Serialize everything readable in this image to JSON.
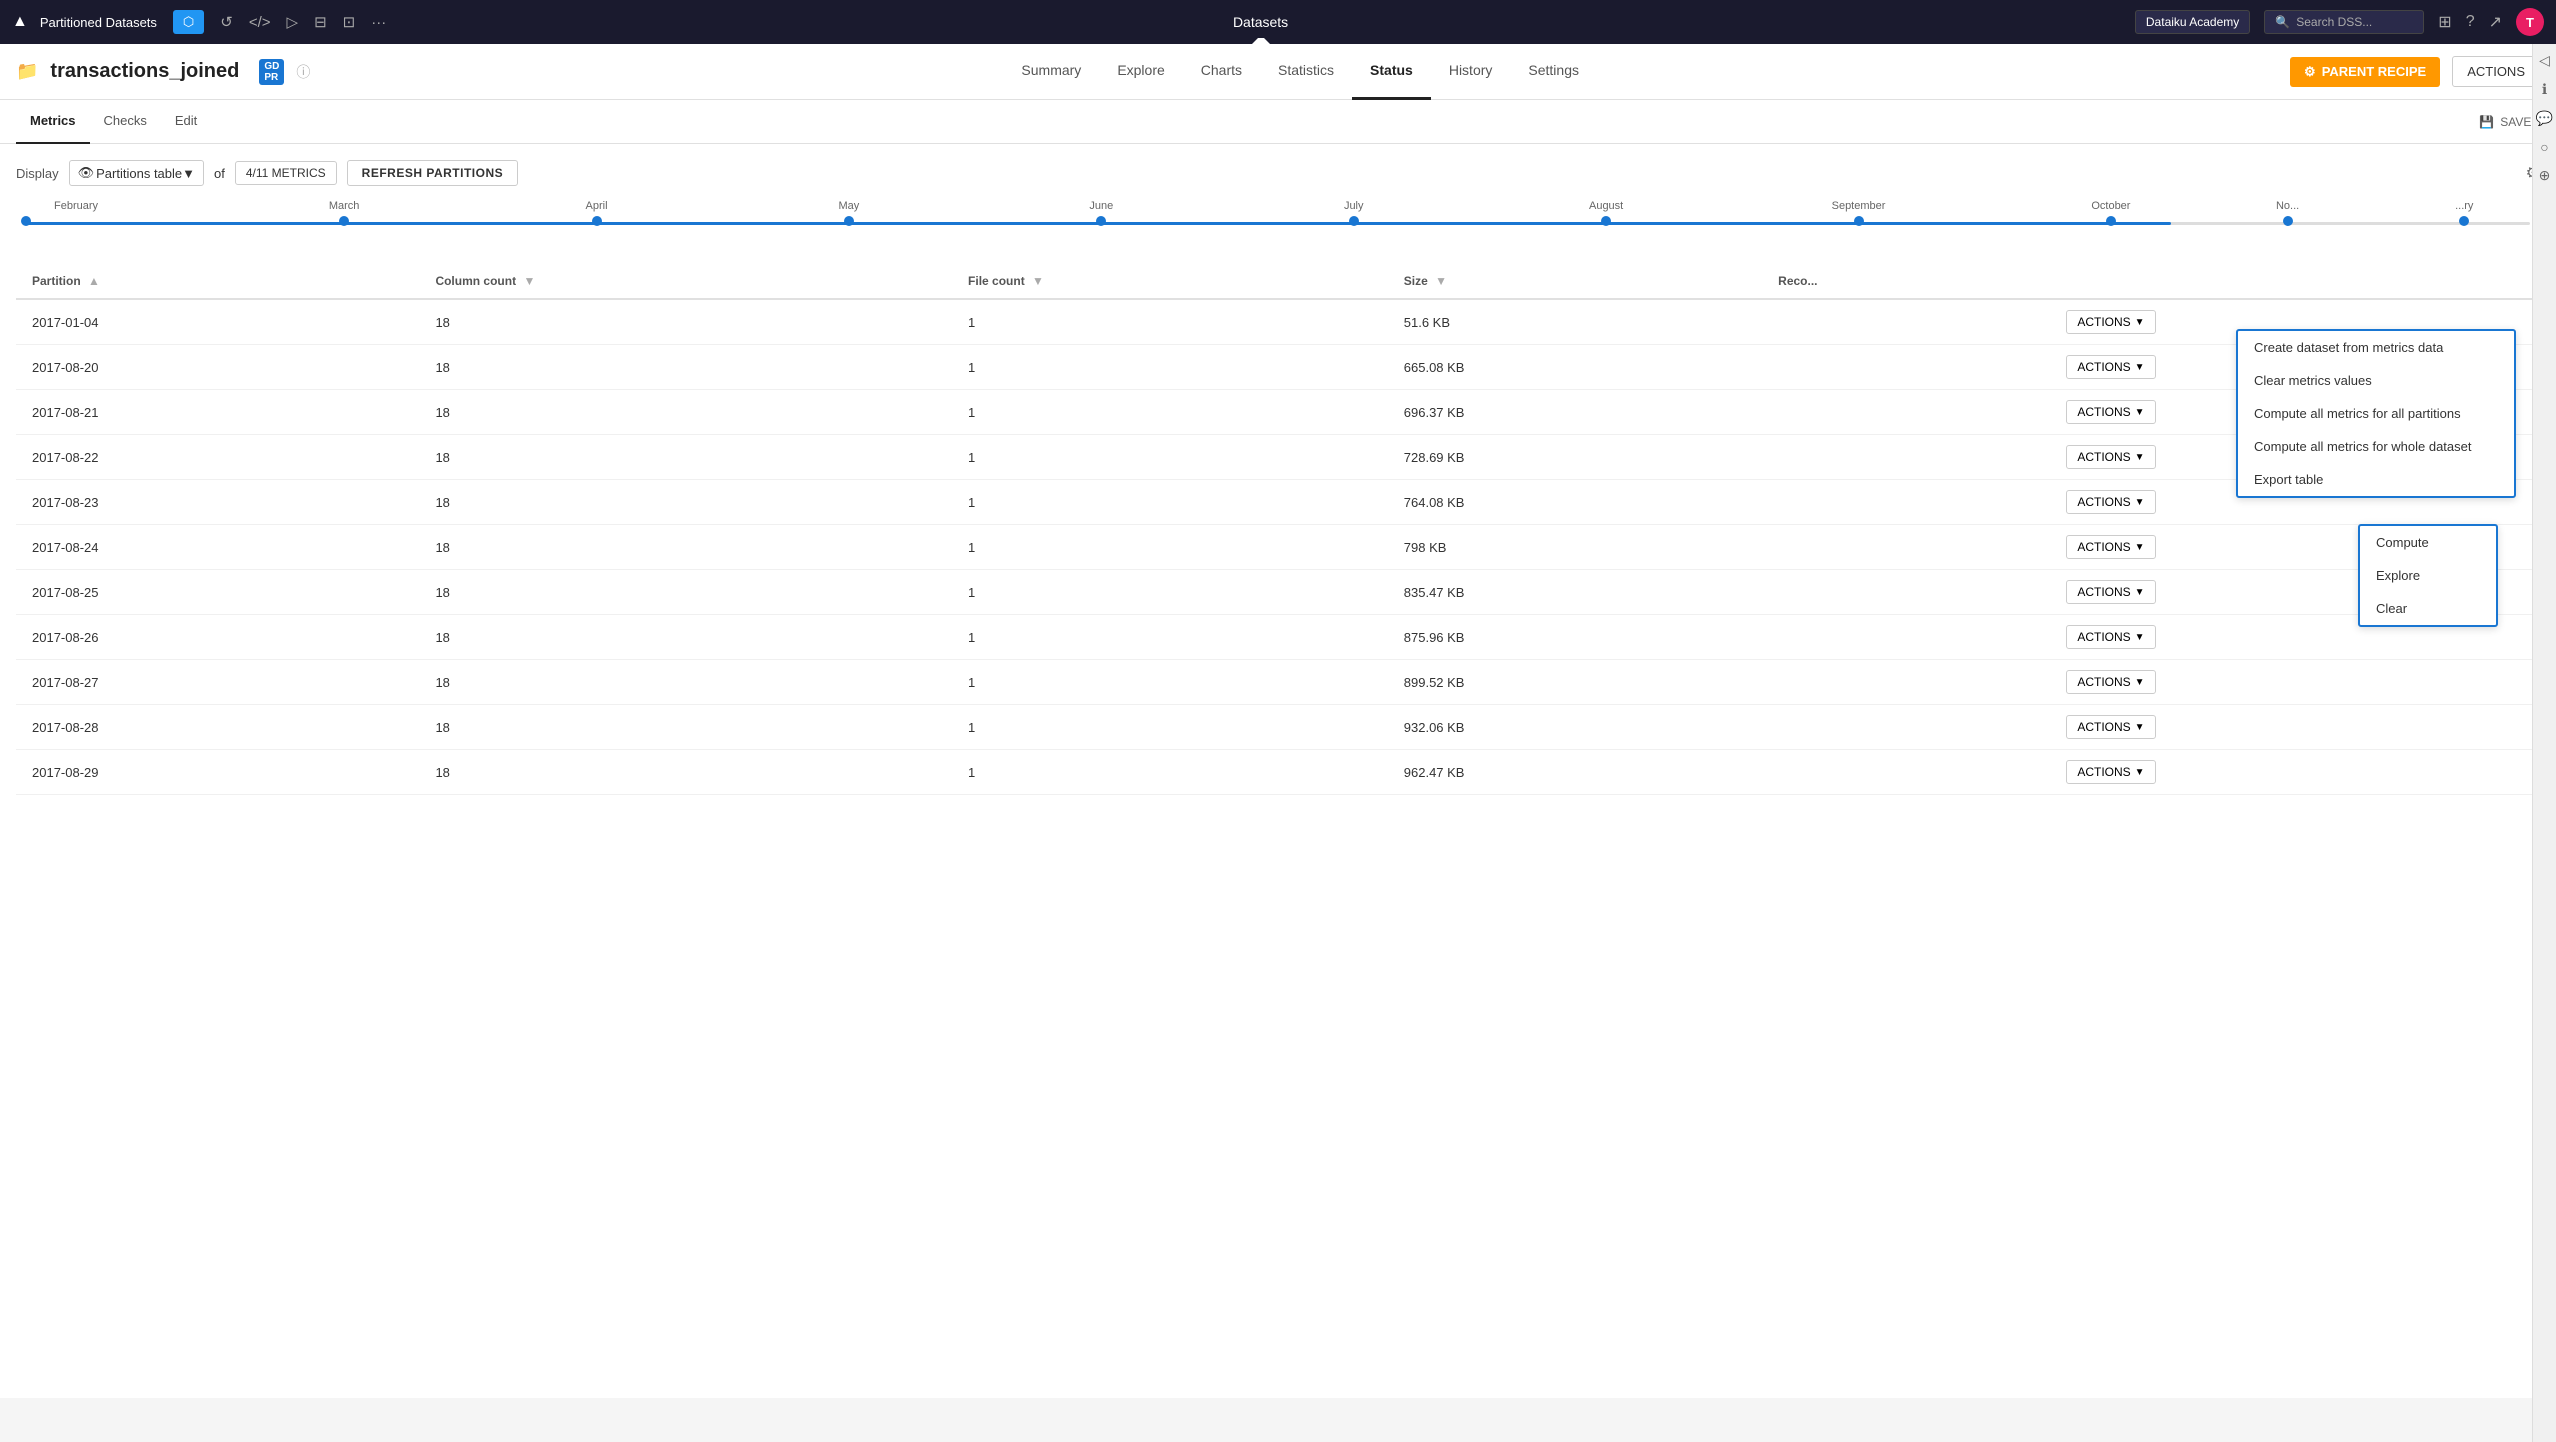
{
  "topNav": {
    "logo": "▲",
    "projectName": "Partitioned Datasets",
    "flowBtn": "▶",
    "icons": [
      "↺",
      "</>",
      "▷",
      "⊟",
      "⊡",
      "···"
    ],
    "datasetsLink": "Datasets",
    "academyBtn": "Dataiku Academy",
    "searchPlaceholder": "Search DSS...",
    "helpIcon": "?",
    "trendIcon": "↗",
    "avatarInitial": "T"
  },
  "secondBar": {
    "datasetName": "transactions_joined",
    "badgeGdpr": "GD",
    "badgePr": "PR",
    "tabs": [
      {
        "label": "Summary",
        "active": false
      },
      {
        "label": "Explore",
        "active": false
      },
      {
        "label": "Charts",
        "active": false
      },
      {
        "label": "Statistics",
        "active": false
      },
      {
        "label": "Status",
        "active": true
      },
      {
        "label": "History",
        "active": false
      },
      {
        "label": "Settings",
        "active": false
      }
    ],
    "parentRecipeBtn": "PARENT RECIPE",
    "actionsBtn": "ACTIONS"
  },
  "subTabs": [
    {
      "label": "Metrics",
      "active": true
    },
    {
      "label": "Checks",
      "active": false
    },
    {
      "label": "Edit",
      "active": false
    }
  ],
  "savedBtn": "SAVED",
  "displayBar": {
    "displayLabel": "Display",
    "selectValue": "Partitions table",
    "metricsLabel": "4/11 METRICS",
    "refreshBtn": "REFRESH PARTITIONS"
  },
  "timeline": {
    "months": [
      "February",
      "March",
      "April",
      "May",
      "June",
      "July",
      "August",
      "September",
      "October",
      "No...",
      "...ry"
    ]
  },
  "table": {
    "columns": [
      {
        "label": "Partition",
        "sortable": true
      },
      {
        "label": "Column count",
        "sortable": true
      },
      {
        "label": "File count",
        "sortable": true
      },
      {
        "label": "Size",
        "sortable": true
      },
      {
        "label": "Reco...",
        "sortable": false
      }
    ],
    "rows": [
      {
        "partition": "2017-01-04",
        "columnCount": "18",
        "fileCount": "1",
        "size": "51.6 KB"
      },
      {
        "partition": "2017-08-20",
        "columnCount": "18",
        "fileCount": "1",
        "size": "665.08 KB"
      },
      {
        "partition": "2017-08-21",
        "columnCount": "18",
        "fileCount": "1",
        "size": "696.37 KB"
      },
      {
        "partition": "2017-08-22",
        "columnCount": "18",
        "fileCount": "1",
        "size": "728.69 KB"
      },
      {
        "partition": "2017-08-23",
        "columnCount": "18",
        "fileCount": "1",
        "size": "764.08 KB"
      },
      {
        "partition": "2017-08-24",
        "columnCount": "18",
        "fileCount": "1",
        "size": "798 KB"
      },
      {
        "partition": "2017-08-25",
        "columnCount": "18",
        "fileCount": "1",
        "size": "835.47 KB"
      },
      {
        "partition": "2017-08-26",
        "columnCount": "18",
        "fileCount": "1",
        "size": "875.96 KB"
      },
      {
        "partition": "2017-08-27",
        "columnCount": "18",
        "fileCount": "1",
        "size": "899.52 KB"
      },
      {
        "partition": "2017-08-28",
        "columnCount": "18",
        "fileCount": "1",
        "size": "932.06 KB"
      },
      {
        "partition": "2017-08-29",
        "columnCount": "18",
        "fileCount": "1",
        "size": "962.47 KB"
      }
    ],
    "actionsBtn": "ACTIONS"
  },
  "gearDropdown": {
    "items": [
      "Create dataset from metrics data",
      "Clear metrics values",
      "Compute all metrics for all partitions",
      "Compute all metrics for whole dataset",
      "Export table"
    ]
  },
  "rowActionsDropdown": {
    "items": [
      "Compute",
      "Explore",
      "Clear"
    ]
  }
}
